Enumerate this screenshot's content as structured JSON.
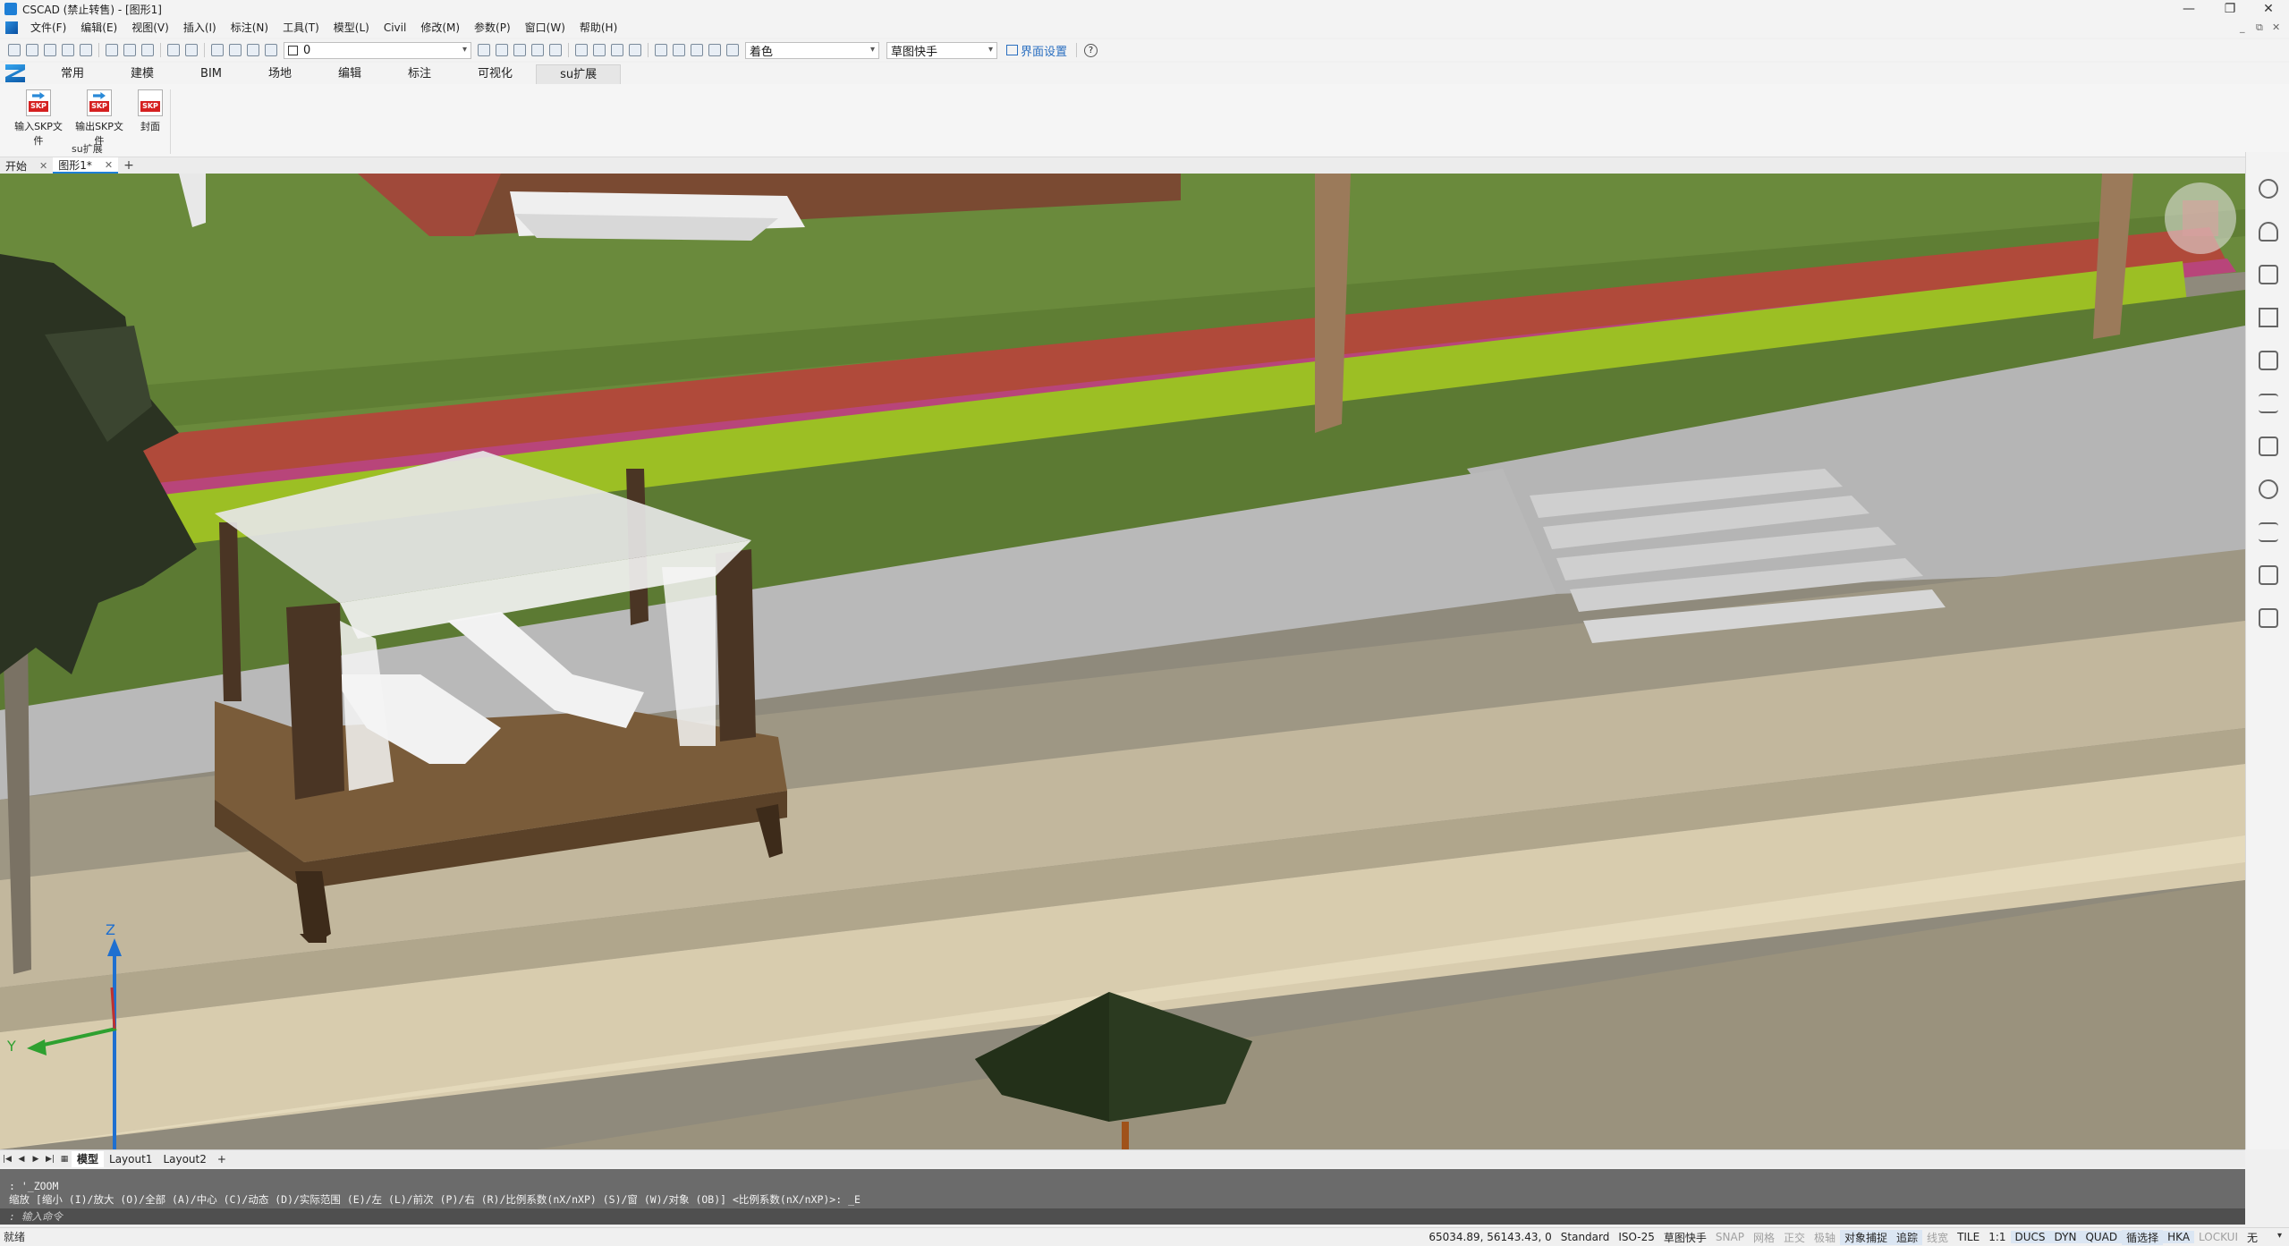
{
  "window": {
    "title": "CSCAD (禁止转售) - [图形1]",
    "controls": [
      "—",
      "❐",
      "✕"
    ]
  },
  "menu": {
    "items": [
      "文件(F)",
      "编辑(E)",
      "视图(V)",
      "插入(I)",
      "标注(N)",
      "工具(T)",
      "模型(L)",
      "Civil",
      "修改(M)",
      "参数(P)",
      "窗口(W)",
      "帮助(H)"
    ],
    "mdi_controls": [
      "_",
      "⧉",
      "✕"
    ]
  },
  "toolbar": {
    "layer_value": "0",
    "visual_style": "着色",
    "workspace": "草图快手",
    "interface_settings": "界面设置",
    "help_icon": "?"
  },
  "ribbon": {
    "tabs": [
      "常用",
      "建模",
      "BIM",
      "场地",
      "编辑",
      "标注",
      "可视化",
      "su扩展"
    ],
    "active_tab": "su扩展",
    "buttons": [
      {
        "label": "输入SKP文件",
        "icon": "skp-import-icon",
        "badge": "SKP"
      },
      {
        "label": "输出SKP文件",
        "icon": "skp-export-icon",
        "badge": "SKP"
      },
      {
        "label": "封面",
        "icon": "skp-cover-icon",
        "badge": "SKP"
      }
    ],
    "group_label": "su扩展"
  },
  "doc_tabs": {
    "tabs": [
      {
        "label": "开始",
        "close": "✕",
        "active": false
      },
      {
        "label": "图形1*",
        "close": "✕",
        "active": true
      }
    ],
    "add": "+"
  },
  "viewport": {
    "axis_z": "Z",
    "axis_y": "Y"
  },
  "layout_tabs": {
    "nav": [
      "|◀",
      "◀",
      "▶",
      "▶|",
      "▦"
    ],
    "tabs": [
      "模型",
      "Layout1",
      "Layout2"
    ],
    "active": "模型",
    "add": "+"
  },
  "command": {
    "history_line1": ": '_ZOOM",
    "history_line2": "缩放 [缩小 (I)/放大 (O)/全部 (A)/中心 (C)/动态 (D)/实际范围 (E)/左 (L)/前次 (P)/右 (R)/比例系数(nX/nXP) (S)/窗 (W)/对象 (OB)] <比例系数(nX/nXP)>: _E",
    "input_placeholder": ": 输入命令"
  },
  "status": {
    "ready": "就绪",
    "coords": "65034.89, 56143.43, 0",
    "text_style": "Standard",
    "dim_style": "ISO-25",
    "workspace": "草图快手",
    "toggles": [
      {
        "label": "SNAP",
        "on": false
      },
      {
        "label": "网格",
        "on": false
      },
      {
        "label": "正交",
        "on": false
      },
      {
        "label": "极轴",
        "on": false
      },
      {
        "label": "对象捕捉",
        "on": true
      },
      {
        "label": "追踪",
        "on": true
      },
      {
        "label": "线宽",
        "on": false
      },
      {
        "label": "TILE",
        "on": true
      },
      {
        "label": "1:1",
        "on": true
      },
      {
        "label": "DUCS",
        "on": true
      },
      {
        "label": "DYN",
        "on": true
      },
      {
        "label": "QUAD",
        "on": true
      },
      {
        "label": "循选择",
        "on": true
      },
      {
        "label": "HKA",
        "on": true
      },
      {
        "label": "LOCKUI",
        "on": false
      },
      {
        "label": "无",
        "on": true
      }
    ],
    "menu_arrow": "▾"
  }
}
